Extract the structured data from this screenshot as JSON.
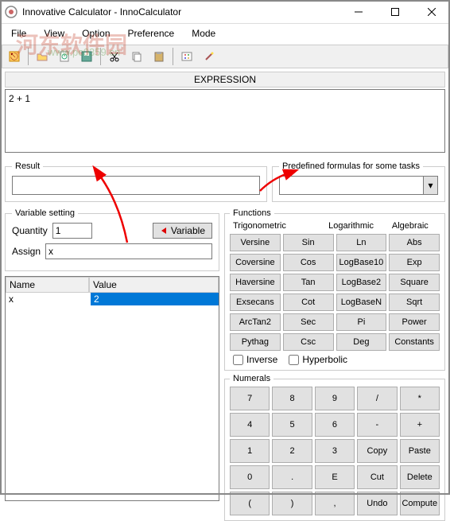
{
  "window": {
    "title": "Innovative Calculator - InnoCalculator"
  },
  "menu": {
    "file": "File",
    "view": "View",
    "option": "Option",
    "preference": "Preference",
    "mode": "Mode"
  },
  "labels": {
    "expression": "EXPRESSION",
    "result": "Result",
    "formulas": "Predefined formulas for some tasks",
    "varset": "Variable setting",
    "quantity": "Quantity",
    "assign": "Assign",
    "variable_btn": "Variable",
    "functions": "Functions",
    "numerals": "Numerals",
    "inverse": "Inverse",
    "hyperbolic": "Hyperbolic"
  },
  "inputs": {
    "expression": "2 + 1",
    "result": "",
    "quantity": "1",
    "assign": "x"
  },
  "table": {
    "col_name": "Name",
    "col_value": "Value",
    "row0_name": "x",
    "row0_value": "2"
  },
  "func_headers": {
    "trig": "Trigonometric",
    "log": "Logarithmic",
    "alg": "Algebraic"
  },
  "funcs": {
    "r0c0": "Versine",
    "r0c1": "Sin",
    "r0c2": "Ln",
    "r0c3": "Abs",
    "r1c0": "Coversine",
    "r1c1": "Cos",
    "r1c2": "LogBase10",
    "r1c3": "Exp",
    "r2c0": "Haversine",
    "r2c1": "Tan",
    "r2c2": "LogBase2",
    "r2c3": "Square",
    "r3c0": "Exsecans",
    "r3c1": "Cot",
    "r3c2": "LogBaseN",
    "r3c3": "Sqrt",
    "r4c0": "ArcTan2",
    "r4c1": "Sec",
    "r4c2": "Pi",
    "r4c3": "Power",
    "r5c0": "Pythag",
    "r5c1": "Csc",
    "r5c2": "Deg",
    "r5c3": "Constants"
  },
  "nums": {
    "r0c0": "7",
    "r0c1": "8",
    "r0c2": "9",
    "r0c3": "/",
    "r0c4": "*",
    "r1c0": "4",
    "r1c1": "5",
    "r1c2": "6",
    "r1c3": "-",
    "r1c4": "+",
    "r2c0": "1",
    "r2c1": "2",
    "r2c2": "3",
    "r2c3": "Copy",
    "r2c4": "Paste",
    "r3c0": "0",
    "r3c1": ".",
    "r3c2": "E",
    "r3c3": "Cut",
    "r3c4": "Delete",
    "r4c0": "(",
    "r4c1": ")",
    "r4c2": ",",
    "r4c3": "Undo",
    "r4c4": "Compute"
  },
  "watermark": {
    "main": "河东软件园",
    "url": "www.pc0359.cn"
  }
}
